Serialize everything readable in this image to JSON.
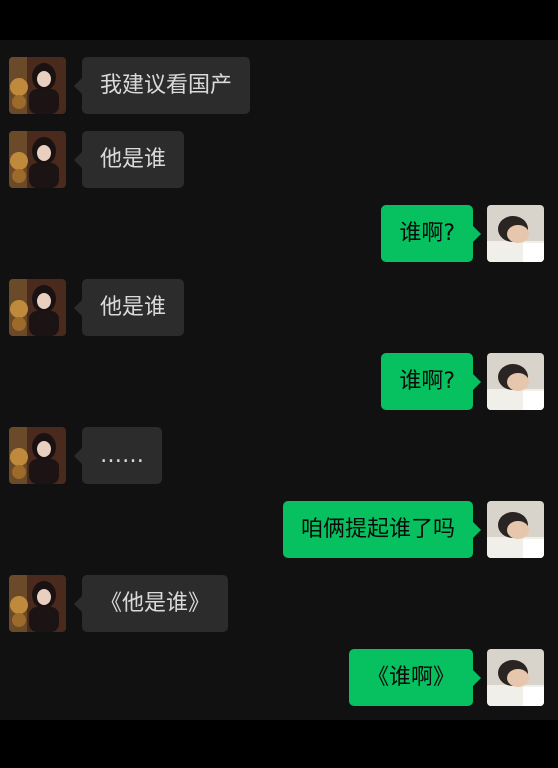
{
  "colors": {
    "chat_background": "#111111",
    "incoming_bubble": "#2c2c2c",
    "outgoing_bubble": "#07c160",
    "incoming_text": "#dadada",
    "outgoing_text": "#0a0a0a"
  },
  "messages": [
    {
      "side": "left",
      "text": "我建议看国产"
    },
    {
      "side": "left",
      "text": "他是谁"
    },
    {
      "side": "right",
      "text": "谁啊?"
    },
    {
      "side": "left",
      "text": "他是谁"
    },
    {
      "side": "right",
      "text": "谁啊?"
    },
    {
      "side": "left",
      "text": "……"
    },
    {
      "side": "right",
      "text": "咱俩提起谁了吗"
    },
    {
      "side": "left",
      "text": "《他是谁》"
    },
    {
      "side": "right",
      "text": "《谁啊》"
    }
  ]
}
